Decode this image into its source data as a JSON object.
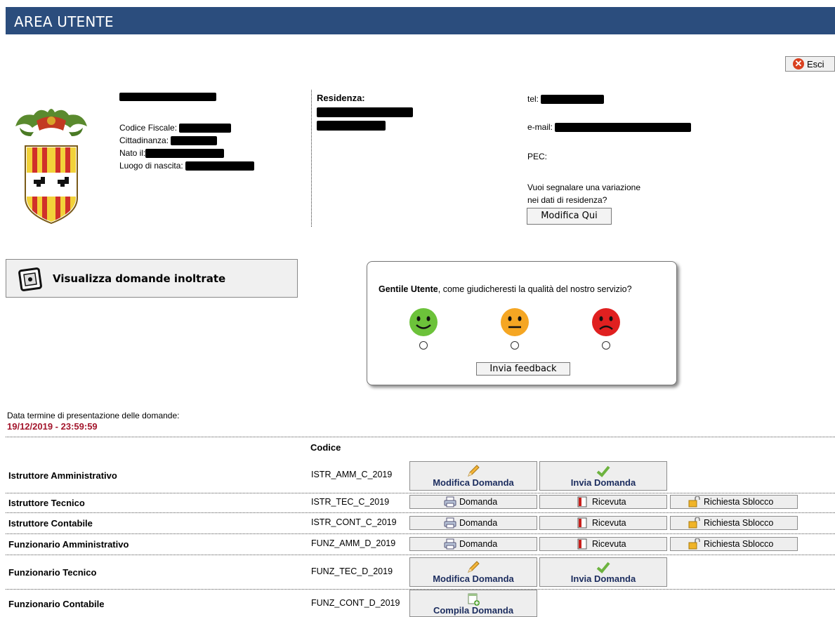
{
  "header": {
    "title": "AREA UTENTE"
  },
  "logout": {
    "label": "Esci"
  },
  "profile": {
    "codice_fiscale_label": "Codice Fiscale:",
    "cittadinanza_label": "Cittadinanza:",
    "nato_label": "Nato il:",
    "luogo_label": "Luogo di nascita:",
    "residenza_label": "Residenza:",
    "tel_label": "tel:",
    "email_label": "e-mail:",
    "pec_label": "PEC:",
    "variation_line1": "Vuoi segnalare una variazione",
    "variation_line2": "nei dati di residenza?",
    "modifica_button": "Modifica Qui"
  },
  "view_applications": {
    "label": "Visualizza domande inoltrate"
  },
  "feedback": {
    "greeting_bold": "Gentile Utente",
    "question": ", come giudicheresti la qualità del nostro servizio?",
    "submit": "Invia feedback",
    "options": [
      "happy",
      "neutral",
      "sad"
    ]
  },
  "deadline": {
    "label": "Data termine di presentazione delle domande:",
    "value": "19/12/2019 - 23:59:59"
  },
  "table": {
    "code_header": "Codice",
    "rows": [
      {
        "name": "Istruttore Amministrativo",
        "code": "ISTR_AMM_C_2019",
        "actions": [
          "Modifica Domanda",
          "Invia Domanda"
        ]
      },
      {
        "name": "Istruttore Tecnico",
        "code": "ISTR_TEC_C_2019",
        "actions": [
          "Domanda",
          "Ricevuta",
          "Richiesta Sblocco"
        ]
      },
      {
        "name": "Istruttore Contabile",
        "code": "ISTR_CONT_C_2019",
        "actions": [
          "Domanda",
          "Ricevuta",
          "Richiesta Sblocco"
        ]
      },
      {
        "name": "Funzionario Amministrativo",
        "code": "FUNZ_AMM_D_2019",
        "actions": [
          "Domanda",
          "Ricevuta",
          "Richiesta Sblocco"
        ]
      },
      {
        "name": "Funzionario Tecnico",
        "code": "FUNZ_TEC_D_2019",
        "actions": [
          "Modifica Domanda",
          "Invia Domanda"
        ]
      },
      {
        "name": "Funzionario Contabile",
        "code": "FUNZ_CONT_D_2019",
        "actions": [
          "Compila Domanda"
        ]
      }
    ]
  },
  "colors": {
    "header_bg": "#2b4d7d",
    "deadline": "#a3162c",
    "button_text": "#1b2c5e"
  }
}
